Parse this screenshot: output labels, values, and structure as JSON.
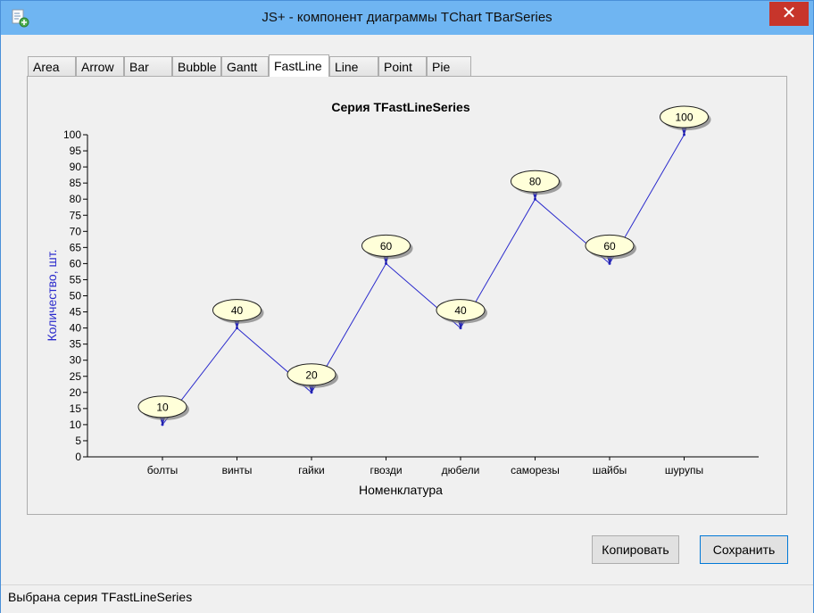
{
  "window": {
    "title": "JS+ - компонент диаграммы TChart TBarSeries",
    "close_glyph": "✕"
  },
  "tabs": [
    {
      "label": "Area",
      "active": false
    },
    {
      "label": "Arrow",
      "active": false
    },
    {
      "label": "Bar",
      "active": false
    },
    {
      "label": "Bubble",
      "active": false
    },
    {
      "label": "Gantt",
      "active": false
    },
    {
      "label": "FastLine",
      "active": true
    },
    {
      "label": "Line",
      "active": false
    },
    {
      "label": "Point",
      "active": false
    },
    {
      "label": "Pie",
      "active": false
    }
  ],
  "chart_data": {
    "type": "line",
    "title": "Серия TFastLineSeries",
    "xlabel": "Номенклатура",
    "ylabel": "Количество, шт.",
    "categories": [
      "болты",
      "винты",
      "гайки",
      "гвозди",
      "дюбели",
      "саморезы",
      "шайбы",
      "шурупы"
    ],
    "series": [
      {
        "values": [
          10,
          40,
          20,
          60,
          40,
          80,
          60,
          100
        ]
      }
    ],
    "ylim": [
      0,
      100
    ],
    "ytick_step": 5,
    "data_labels": true,
    "line_color": "#2b2bcc",
    "label_fill": "#ffffd9",
    "ylabel_color": "#2b2bcc",
    "grid": false,
    "legend": "none"
  },
  "buttons": {
    "copy_label": "Копировать",
    "save_label": "Сохранить"
  },
  "status": {
    "text": "Выбрана серия TFastLineSeries"
  }
}
